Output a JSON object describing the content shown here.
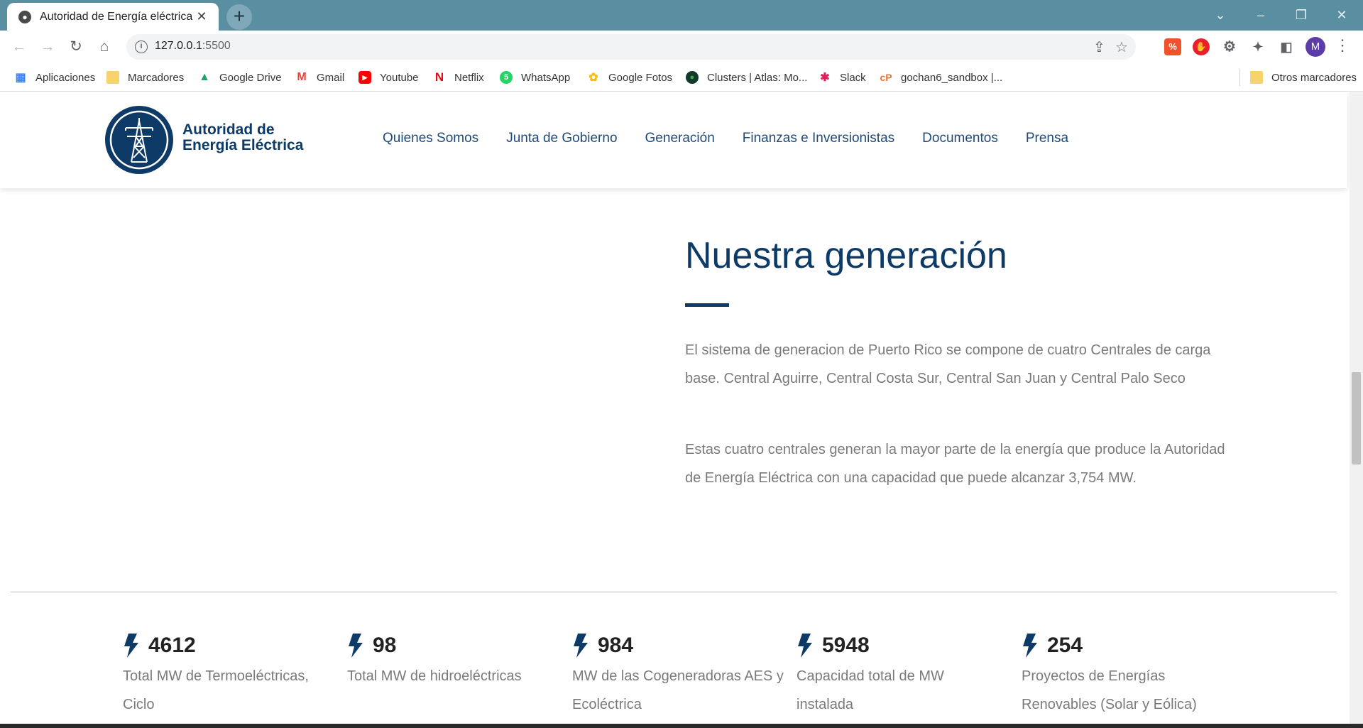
{
  "browser": {
    "tab_title": "Autoridad de Energía eléctrica",
    "url_host": "127.0.0.1",
    "url_port": ":5500",
    "bookmarks": [
      {
        "label": "Aplicaciones",
        "icon": "apps-grid-icon"
      },
      {
        "label": "Marcadores",
        "icon": "folder-icon"
      },
      {
        "label": "Google Drive",
        "icon": "google-drive-icon"
      },
      {
        "label": "Gmail",
        "icon": "gmail-icon"
      },
      {
        "label": "Youtube",
        "icon": "youtube-icon"
      },
      {
        "label": "Netflix",
        "icon": "netflix-icon"
      },
      {
        "label": "WhatsApp",
        "icon": "whatsapp-icon"
      },
      {
        "label": "Google Fotos",
        "icon": "google-photos-icon"
      },
      {
        "label": "Clusters | Atlas: Mo...",
        "icon": "mongodb-icon"
      },
      {
        "label": "Slack",
        "icon": "slack-icon"
      },
      {
        "label": "gochan6_sandbox |...",
        "icon": "cpanel-icon"
      }
    ],
    "other_bookmarks": "Otros marcadores",
    "profile_initial": "M"
  },
  "site": {
    "logo_line1": "Autoridad de",
    "logo_line2": "Energía Eléctrica",
    "nav": [
      "Quienes Somos",
      "Junta de Gobierno",
      "Generación",
      "Finanzas e Inversionistas",
      "Documentos",
      "Prensa"
    ]
  },
  "content": {
    "title": "Nuestra generación",
    "paragraph1": "El sistema de generacion de Puerto Rico se compone de cuatro Centrales de carga base. Central Aguirre, Central Costa Sur, Central San Juan y Central Palo Seco",
    "paragraph2": "Estas cuatro centrales generan la mayor parte de la energía que produce la Autoridad de Energía Eléctrica con una capacidad que puede alcanzar 3,754 MW."
  },
  "stats": [
    {
      "value": "4612",
      "label": "Total MW de Termoeléctricas, Ciclo"
    },
    {
      "value": "98",
      "label": "Total MW de hidroeléctricas"
    },
    {
      "value": "984",
      "label": "MW de las Cogeneradoras AES y Ecoléctrica"
    },
    {
      "value": "5948",
      "label": "Capacidad total de MW instalada"
    },
    {
      "value": "254",
      "label": "Proyectos de Energías Renovables (Solar y Eólica)"
    }
  ],
  "colors": {
    "brand_navy": "#0d3a66",
    "titlebar": "#5a8fa2",
    "body_text": "#7a7a7a"
  }
}
